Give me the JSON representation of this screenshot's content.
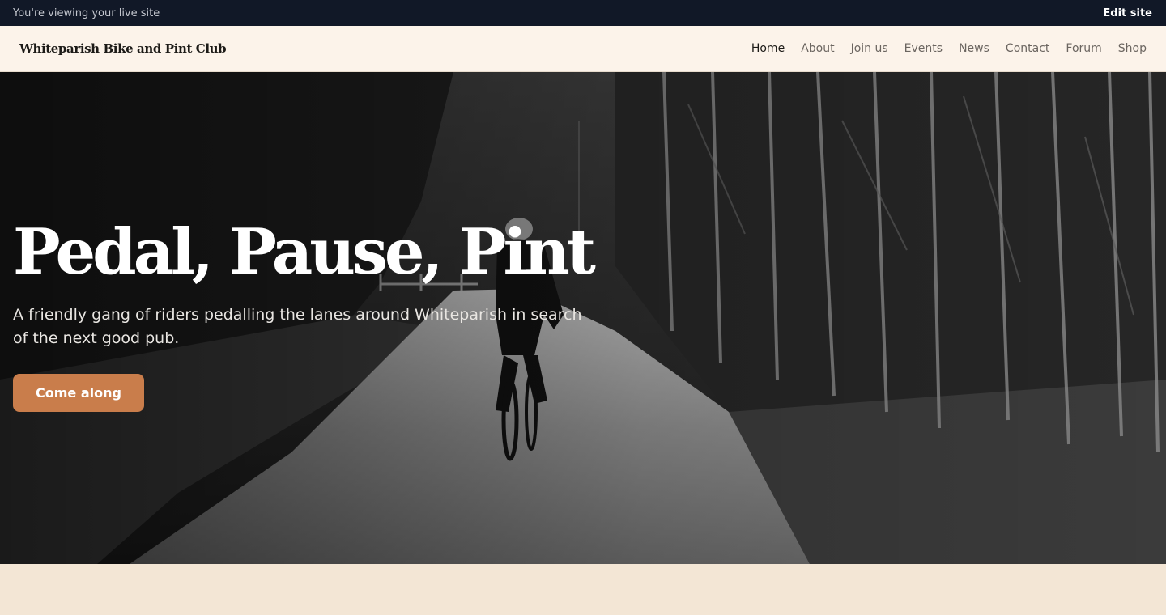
{
  "topbar": {
    "status_text": "You're viewing your live site",
    "edit_label": "Edit site"
  },
  "header": {
    "brand": "Whiteparish Bike and Pint Club",
    "nav": [
      {
        "label": "Home",
        "active": true
      },
      {
        "label": "About"
      },
      {
        "label": "Join us"
      },
      {
        "label": "Events"
      },
      {
        "label": "News"
      },
      {
        "label": "Contact"
      },
      {
        "label": "Forum"
      },
      {
        "label": "Shop"
      }
    ]
  },
  "hero": {
    "title": "Pedal, Pause, Pint",
    "subtitle": "A friendly gang of riders pedalling the lanes around Whiteparish in search of the next good pub.",
    "cta_label": "Come along",
    "image": "black-and-white photo of a cyclist riding down a tree-lined woodland path"
  },
  "colors": {
    "topbar_bg": "#111827",
    "header_bg": "#fcf3ea",
    "cta_bg": "#c97d4b",
    "page_bg": "#f3e6d5"
  }
}
